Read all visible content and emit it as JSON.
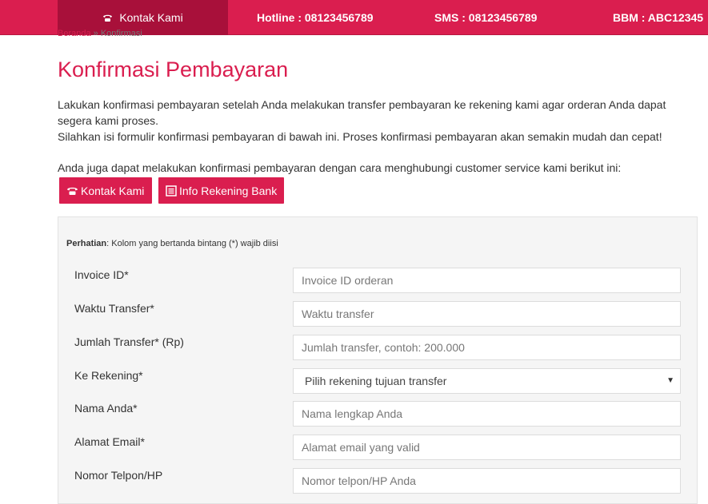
{
  "topbar": {
    "contact_label": "Kontak Kami",
    "hotline": "Hotline : 08123456789",
    "sms": "SMS : 08123456789",
    "bbm": "BBM : ABC12345",
    "contact_icon": "phone-icon"
  },
  "breadcrumb": {
    "home": "Beranda",
    "separator": "»",
    "current": "Konfirmasi"
  },
  "page": {
    "title": "Konfirmasi Pembayaran",
    "intro_1": "Lakukan konfirmasi pembayaran setelah Anda melakukan transfer pembayaran ke rekening kami agar orderan Anda dapat segera kami proses.",
    "intro_2": "Silahkan isi formulir konfirmasi pembayaran di bawah ini. Proses konfirmasi pembayaran akan semakin mudah dan cepat!",
    "contact_line": "Anda juga dapat melakukan konfirmasi pembayaran dengan cara menghubungi customer service kami berikut ini:"
  },
  "buttons": {
    "kontak": "Kontak Kami",
    "rekening": "Info Rekening Bank"
  },
  "form": {
    "note_bold": "Perhatian",
    "note_rest": ": Kolom yang bertanda bintang (*) wajib diisi",
    "invoice": {
      "label": "Invoice ID*",
      "placeholder": "Invoice ID orderan"
    },
    "waktu": {
      "label": "Waktu Transfer*",
      "placeholder": "Waktu transfer"
    },
    "jumlah": {
      "label": "Jumlah Transfer* (Rp)",
      "placeholder": "Jumlah transfer, contoh: 200.000"
    },
    "rekening": {
      "label": "Ke Rekening*",
      "selected": "Pilih rekening tujuan transfer"
    },
    "nama": {
      "label": "Nama Anda*",
      "placeholder": "Nama lengkap Anda"
    },
    "email": {
      "label": "Alamat Email*",
      "placeholder": "Alamat email yang valid"
    },
    "telpon": {
      "label": "Nomor Telpon/HP",
      "placeholder": "Nomor telpon/HP Anda"
    }
  },
  "colors": {
    "brand": "#da1e4f",
    "brand_dark": "#a8103a"
  }
}
